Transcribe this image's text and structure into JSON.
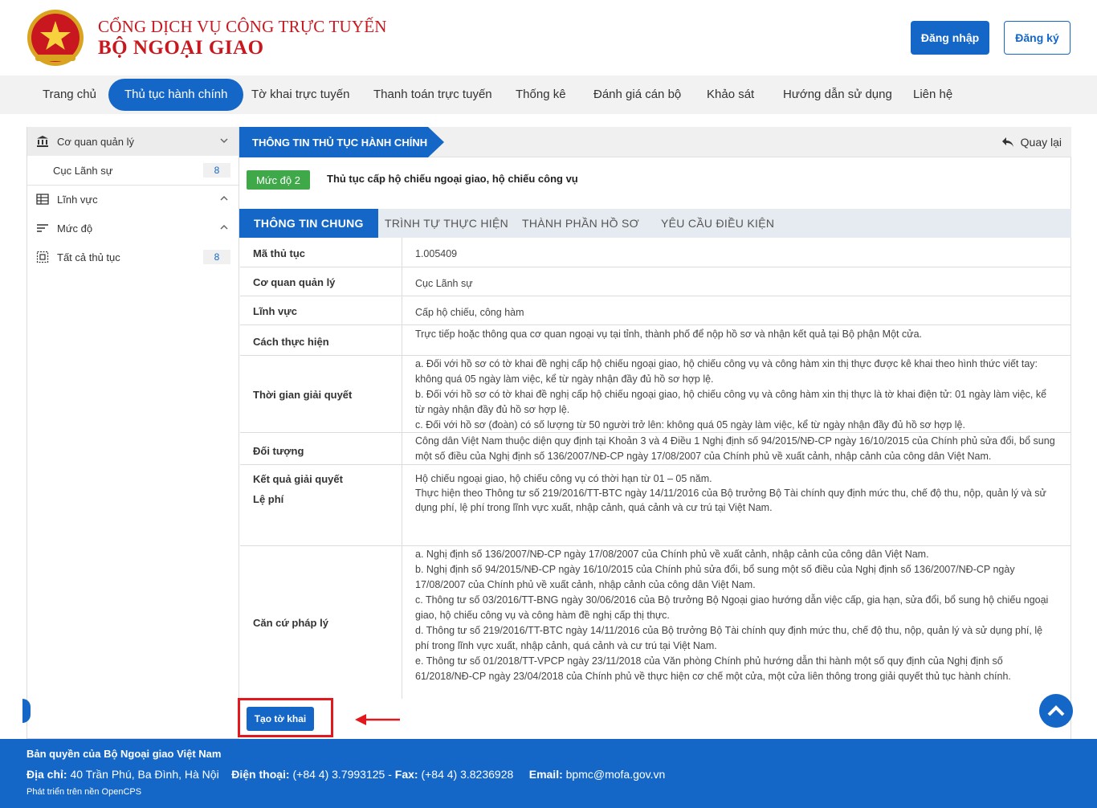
{
  "header": {
    "brand_line1": "CỔNG DỊCH VỤ CÔNG TRỰC TUYẾN",
    "brand_line2": "BỘ NGOẠI GIAO",
    "login_label": "Đăng nhập",
    "register_label": "Đăng ký",
    "brand_color": "#c8171e",
    "accent_color": "#1467c7"
  },
  "nav": {
    "items": [
      {
        "label": "Trang chủ",
        "active": false
      },
      {
        "label": "Thủ tục hành chính",
        "active": true
      },
      {
        "label": "Tờ khai trực tuyến",
        "active": false
      },
      {
        "label": "Thanh toán trực tuyến",
        "active": false
      },
      {
        "label": "Thống kê",
        "active": false
      },
      {
        "label": "Đánh giá cán bộ",
        "active": false
      },
      {
        "label": "Khảo sát",
        "active": false
      },
      {
        "label": "Hướng dẫn sử dụng",
        "active": false
      },
      {
        "label": "Liên hệ",
        "active": false
      }
    ]
  },
  "sidebar": {
    "agency_heading": "Cơ quan quản lý",
    "agency_item": {
      "label": "Cục Lãnh sự",
      "count": "8"
    },
    "field_heading": "Lĩnh vực",
    "level_heading": "Mức độ",
    "all_item": {
      "label": "Tất cả thủ tục",
      "count": "8"
    }
  },
  "main": {
    "section_title": "THÔNG TIN THỦ TỤC HÀNH CHÍNH",
    "back_label": "Quay lại",
    "level_badge": "Mức độ 2",
    "procedure_title": "Thủ tục cấp hộ chiếu ngoại giao, hộ chiếu công vụ",
    "tabs": [
      "THÔNG TIN CHUNG",
      "TRÌNH TỰ THỰC HIỆN",
      "THÀNH PHẦN HỒ SƠ",
      "YÊU CẦU ĐIỀU KIỆN"
    ],
    "active_tab": "THÔNG TIN CHUNG",
    "rows": {
      "code": {
        "label": "Mã thủ tục",
        "value": "1.005409"
      },
      "agency": {
        "label": "Cơ quan quản lý",
        "value": "Cục Lãnh sự"
      },
      "field": {
        "label": "Lĩnh vực",
        "value": "Cấp hộ chiếu, công hàm"
      },
      "method": {
        "label": "Cách thực hiện",
        "value": "Trực tiếp hoặc thông qua cơ quan ngoại vụ tại tỉnh, thành phố để nộp hồ sơ và nhận kết quả tại Bộ phận Một cửa."
      },
      "time": {
        "label": "Thời gian giải quyết",
        "lines": [
          "a.     Đối với hồ sơ có tờ khai đề nghị cấp hộ chiếu ngoại giao, hộ chiếu công vụ và công hàm xin thị thực được kê khai theo hình thức viết tay: không quá 05 ngày làm việc, kể từ ngày nhận đầy đủ hồ sơ hợp lệ.",
          "b.     Đối với hồ sơ có tờ khai đề nghị cấp hộ chiếu ngoại giao, hộ chiếu công vụ và công hàm xin thị thực là tờ khai điện tử: 01 ngày làm việc, kể từ ngày nhận đầy đủ hồ sơ hợp lệ.",
          "c.     Đối với hồ sơ (đoàn) có số lượng từ 50 người trở lên: không quá 05 ngày làm việc, kể từ ngày nhận đầy đủ hồ sơ hợp lệ."
        ]
      },
      "subject": {
        "label": "Đối tượng",
        "value": "Công dân Việt Nam thuộc diện quy định tại Khoản 3 và 4 Điều 1 Nghị định số 94/2015/NĐ-CP ngày 16/10/2015 của Chính phủ sửa đổi, bổ sung một số điều của Nghị định số 136/2007/NĐ-CP ngày 17/08/2007 của Chính phủ về xuất cảnh, nhập cảnh của công dân Việt Nam."
      },
      "result": {
        "label": "Kết quả giải quyết",
        "fee_label": "Lệ phí",
        "lines": [
          "Hộ chiếu ngoại giao, hộ chiếu công vụ có thời hạn từ 01 – 05 năm.",
          "Thực hiện theo Thông tư số 219/2016/TT-BTC ngày 14/11/2016 của Bộ trưởng Bộ Tài chính quy định mức thu, chế độ thu, nộp, quản lý và sử dụng phí, lệ phí trong lĩnh vực xuất, nhập cảnh, quá cảnh và cư trú tại Việt Nam."
        ]
      },
      "legal": {
        "label": "Căn cứ pháp lý",
        "lines": [
          "a.     Nghị định số 136/2007/NĐ-CP ngày 17/08/2007 của Chính phủ về xuất cảnh, nhập cảnh của công dân Việt Nam.",
          "b.     Nghị định số 94/2015/NĐ-CP ngày 16/10/2015 của Chính phủ sửa đổi, bổ sung một số điều của Nghị định số 136/2007/NĐ-CP ngày 17/08/2007 của Chính phủ về xuất cảnh, nhập cảnh của công dân Việt Nam.",
          "c.     Thông tư số 03/2016/TT-BNG ngày 30/06/2016 của Bộ trưởng Bộ Ngoại giao hướng dẫn việc cấp, gia hạn, sửa đổi, bổ sung hộ chiếu ngoại giao, hộ chiếu công vụ và công hàm đề nghị cấp thị thực.",
          "d.     Thông tư số 219/2016/TT-BTC ngày 14/11/2016 của Bộ trưởng Bộ Tài chính quy định mức thu, chế độ thu, nộp, quản lý và sử dụng phí, lệ phí trong lĩnh vực xuất, nhập cảnh, quá cảnh và cư trú tại Việt Nam.",
          "e.     Thông tư số 01/2018/TT-VPCP ngày 23/11/2018 của Văn phòng Chính phủ hướng dẫn thi hành một số quy định của Nghị định số 61/2018/NĐ-CP ngày 23/04/2018 của Chính phủ về thực hiện cơ chế một cửa, một cửa liên thông trong giải quyết thủ tục hành chính."
        ]
      }
    },
    "create_button": "Tạo tờ khai"
  },
  "footer": {
    "copyright": "Bản quyền của Bộ Ngoại giao Việt Nam",
    "address_label": "Địa chỉ:",
    "address": "40 Trần Phú, Ba Đình, Hà Nội",
    "phone_label": "Điện thoại:",
    "phone": "(+84 4) 3.7993125",
    "fax_label": "Fax:",
    "fax": "(+84 4) 3.8236928",
    "email_label": "Email:",
    "email": "bpmc@mofa.gov.vn",
    "platform": "Phát triển trên nền OpenCPS"
  }
}
